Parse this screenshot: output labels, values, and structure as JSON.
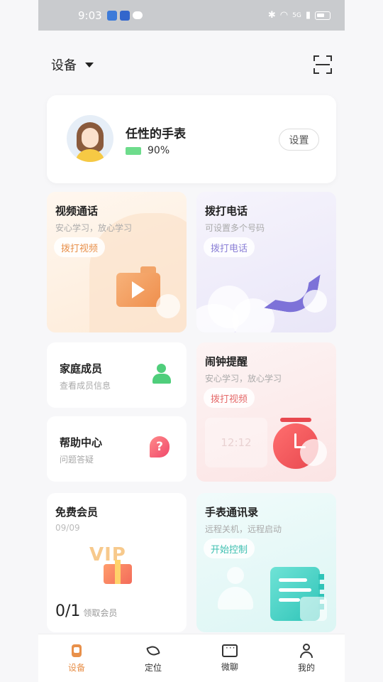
{
  "status_bar": {
    "time": "9:03",
    "network": "5G"
  },
  "header": {
    "device_selector_label": "设备"
  },
  "profile": {
    "name": "任性的手表",
    "battery": "90%",
    "settings_label": "设置"
  },
  "cards": {
    "video_call": {
      "title": "视频通话",
      "subtitle": "安心学习，放心学习",
      "action": "拨打视频"
    },
    "phone_call": {
      "title": "拨打电话",
      "subtitle": "可设置多个号码",
      "action": "拨打电话"
    },
    "family": {
      "title": "家庭成员",
      "subtitle": "查看成员信息"
    },
    "help": {
      "title": "帮助中心",
      "subtitle": "问题答疑"
    },
    "alarm": {
      "title": "闹钟提醒",
      "subtitle": "安心学习，放心学习",
      "action": "拨打视频",
      "clock_text": "12:12"
    },
    "vip": {
      "title": "免费会员",
      "date": "09/09",
      "count": "0/1",
      "count_label": "领取会员",
      "badge_text": "VIP"
    },
    "contacts": {
      "title": "手表通讯录",
      "subtitle": "远程关机，远程启动",
      "action": "开始控制"
    }
  },
  "tabbar": {
    "tabs": [
      {
        "label": "设备",
        "icon": "watch-icon",
        "active": true
      },
      {
        "label": "定位",
        "icon": "location-arrow-icon",
        "active": false
      },
      {
        "label": "微聊",
        "icon": "chat-icon",
        "active": false
      },
      {
        "label": "我的",
        "icon": "user-icon",
        "active": false
      }
    ]
  },
  "colors": {
    "accent": "#e8904a",
    "video_accent": "#e8904a",
    "call_accent": "#8a7fd6",
    "alarm_accent": "#e56a6a",
    "contacts_accent": "#3dbfb0",
    "battery_green": "#6edc8c"
  }
}
